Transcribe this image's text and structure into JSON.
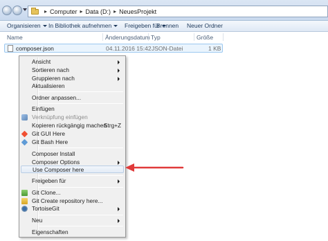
{
  "address": {
    "crumbs": [
      "Computer",
      "Data (D:)",
      "NeuesProjekt"
    ]
  },
  "toolbar": {
    "organize": "Organisieren",
    "library": "In Bibliothek aufnehmen",
    "share": "Freigeben für",
    "burn": "Brennen",
    "new_folder": "Neuer Ordner"
  },
  "columns": {
    "name": "Name",
    "date": "Änderungsdatum",
    "type": "Typ",
    "size": "Größe"
  },
  "file": {
    "name": "composer.json",
    "date": "04.11.2016 15:42",
    "type": "JSON-Datei",
    "size": "1 KB"
  },
  "context_menu": {
    "items": [
      {
        "label": "Ansicht",
        "submenu": true
      },
      {
        "label": "Sortieren nach",
        "submenu": true
      },
      {
        "label": "Gruppieren nach",
        "submenu": true
      },
      {
        "label": "Aktualisieren"
      },
      {
        "label": "Ordner anpassen..."
      },
      {
        "label": "Einfügen"
      },
      {
        "label": "Verknüpfung einfügen",
        "disabled": true
      },
      {
        "label": "Kopieren rückgängig machen",
        "shortcut": "Strg+Z"
      },
      {
        "label": "Git GUI Here",
        "icon": "git-gui-icon"
      },
      {
        "label": "Git Bash Here",
        "icon": "git-bash-icon"
      },
      {
        "label": "Composer Install"
      },
      {
        "label": "Composer Options",
        "submenu": true
      },
      {
        "label": "Use Composer here",
        "highlighted": true
      },
      {
        "label": "Freigeben für",
        "submenu": true
      },
      {
        "label": "Git Clone...",
        "icon": "git-clone-icon"
      },
      {
        "label": "Git Create repository here...",
        "icon": "git-create-repo-icon"
      },
      {
        "label": "TortoiseGit",
        "submenu": true,
        "icon": "tortoisegit-icon"
      },
      {
        "label": "Neu",
        "submenu": true
      },
      {
        "label": "Eigenschaften"
      }
    ]
  },
  "colors": {
    "annotation_arrow": "#e03a3a",
    "highlight_border": "#b9cde5"
  }
}
